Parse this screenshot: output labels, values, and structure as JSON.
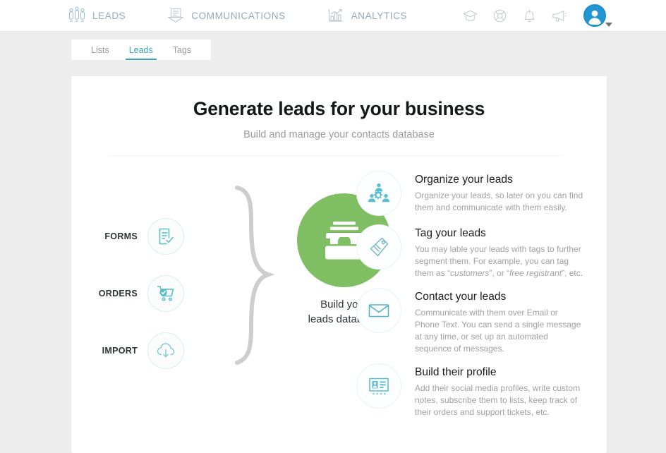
{
  "topnav": {
    "items": [
      {
        "label": "LEADS",
        "icon": "people-group-icon",
        "active": true
      },
      {
        "label": "COMMUNICATIONS",
        "icon": "envelope-letter-icon",
        "active": false
      },
      {
        "label": "ANALYTICS",
        "icon": "bar-chart-icon",
        "active": false
      }
    ],
    "right_icons": [
      {
        "name": "graduation-cap-icon"
      },
      {
        "name": "lifesaver-support-icon"
      },
      {
        "name": "bell-notification-icon"
      },
      {
        "name": "megaphone-announcement-icon"
      }
    ],
    "avatar": {
      "name": "user-avatar",
      "color": "#2196d3"
    }
  },
  "tabs": [
    {
      "label": "Lists",
      "active": false
    },
    {
      "label": "Leads",
      "active": true
    },
    {
      "label": "Tags",
      "active": false
    }
  ],
  "hero": {
    "title": "Generate leads for your business",
    "subtitle": "Build and manage your contacts database"
  },
  "flow": {
    "sources": [
      {
        "label": "FORMS",
        "icon": "form-document-check-icon"
      },
      {
        "label": "ORDERS",
        "icon": "shopping-cart-check-icon"
      },
      {
        "label": "IMPORT",
        "icon": "cloud-download-icon"
      }
    ],
    "hub": {
      "line1": "Build your",
      "line2": "leads database",
      "icon": "file-box-archive-icon",
      "color": "#7fbe63"
    }
  },
  "features": [
    {
      "icon": "organize-people-gear-icon",
      "title": "Organize your leads",
      "desc": "Organize your leads, so later on you can find them and communicate with them easily."
    },
    {
      "icon": "tag-label-icon",
      "title": "Tag your leads",
      "desc_pre": "You may lable your leads with tags to further segment them. For example, you can tag them as “",
      "desc_em1": "customers",
      "desc_mid": "”, or  “",
      "desc_em2": "free registrant",
      "desc_post": "”, etc."
    },
    {
      "icon": "envelope-mail-icon",
      "title": "Contact your leads",
      "desc": "Communicate with them over Email or Phone Text. You can send a single message at any time, or set up an automated sequence of messages."
    },
    {
      "icon": "id-card-profile-icon",
      "title": "Build their profile",
      "desc": "Add their social media profiles, write custom notes, subscribe them to lists, keep track of their orders and support tickets, etc."
    }
  ],
  "colors": {
    "accent_teal": "#3aa8b8",
    "hub_green": "#7fbe63",
    "nav_gray": "#93a9b4",
    "page_bg": "#ededed"
  }
}
